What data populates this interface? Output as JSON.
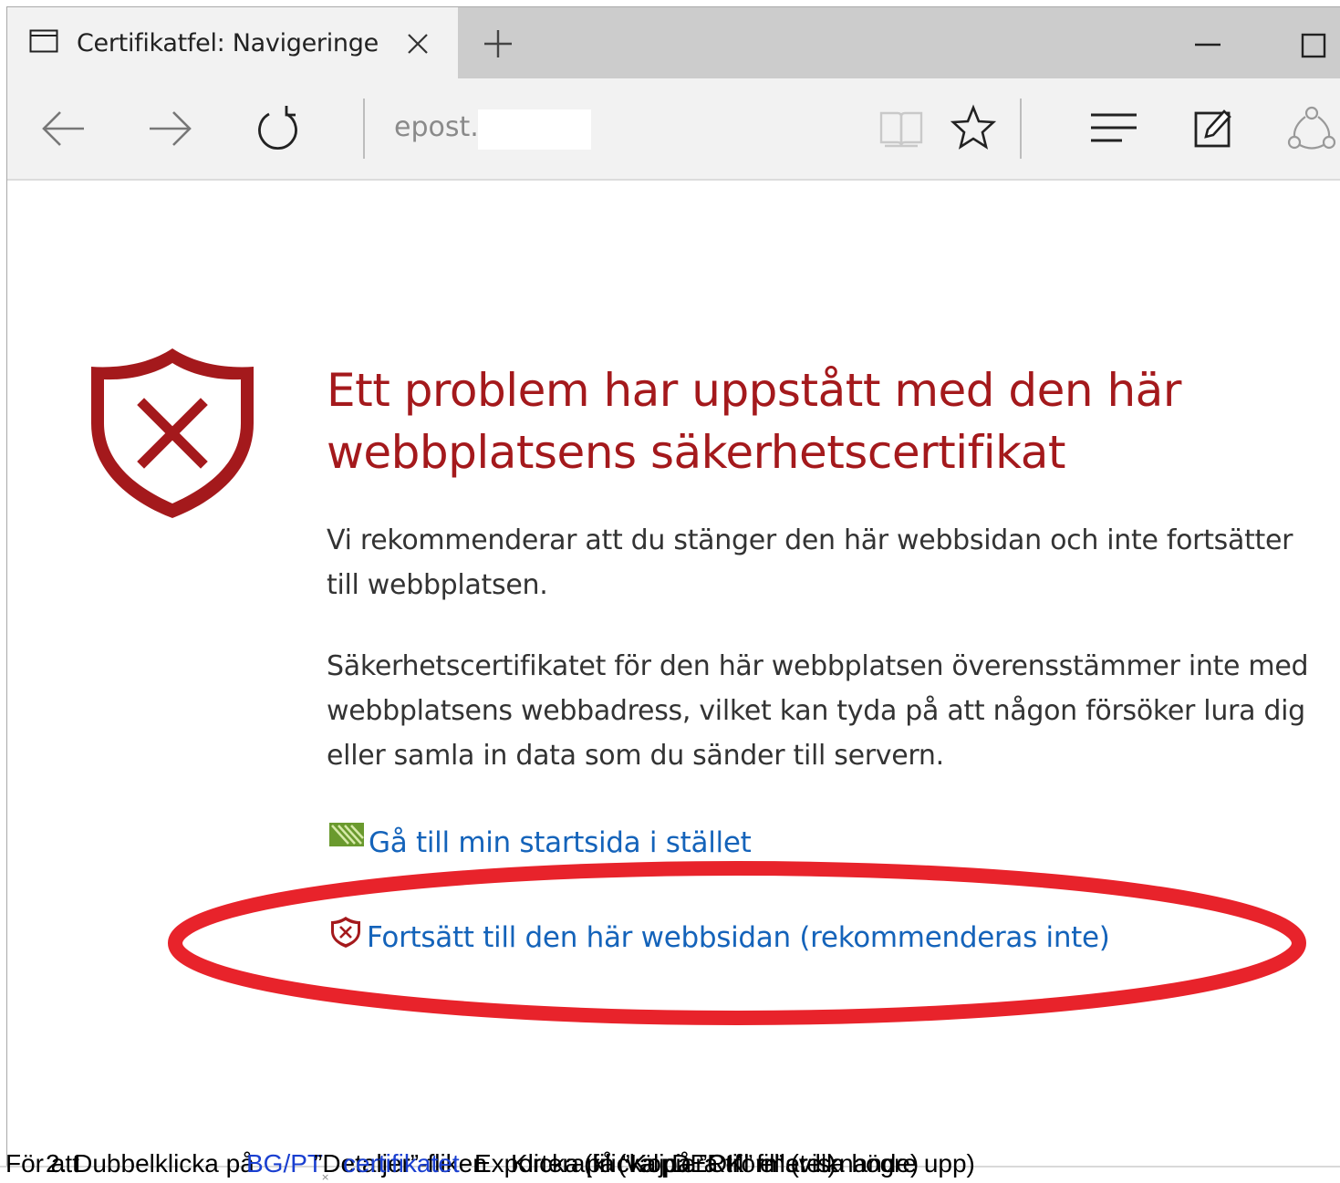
{
  "tab": {
    "title": "Certifikatfel: Navigeringe"
  },
  "navbar": {
    "address_text": "epost."
  },
  "content": {
    "heading": "Ett problem har uppstått med den här webbplatsens säkerhetscertifikat",
    "para1": "Vi rekommenderar att du stänger den här webbsidan och inte fortsätter till webbplatsen.",
    "para2": "Säkerhetscertifikatet för den här webbplatsen överensstämmer inte med webbplatsens webbadress, vilket kan tyda på att någon försöker lura dig eller samla in data som du sänder till servern.",
    "link_home": "Gå till min startsida i stället",
    "link_continue": "Fortsätt till den här webbsidan (rekommenderas inte)"
  },
  "footer": {
    "layer1": "För att",
    "layer2": "2. Dubbelklicka på",
    "layer3_link": "BG/PT",
    "layer4": "”Detaljer”-fliken",
    "layer5_link": "certifikatet",
    "layer6": "Exportera fil (välj DER-formatet)",
    "layer7": "Klicka på ”Kopiera till fil” (visa högre upp)",
    "layer8": "(klicka på ”OK” eller liknande)"
  },
  "colors": {
    "heading_red": "#a4191c",
    "link_blue": "#1463ba",
    "annotation_red": "#e8232b",
    "tab_active": "#f2f2f2",
    "tabstrip": "#cccccc"
  },
  "icons": {
    "tab": "tab-page-icon",
    "close": "close-icon",
    "new_tab": "plus-icon",
    "back": "back-arrow-icon",
    "forward": "forward-arrow-icon",
    "refresh": "refresh-icon",
    "reading": "reading-view-icon",
    "favorite": "star-icon",
    "hub": "hub-icon",
    "note": "web-note-icon",
    "share": "share-icon",
    "shield": "shield-error-icon",
    "home": "home-page-icon"
  }
}
